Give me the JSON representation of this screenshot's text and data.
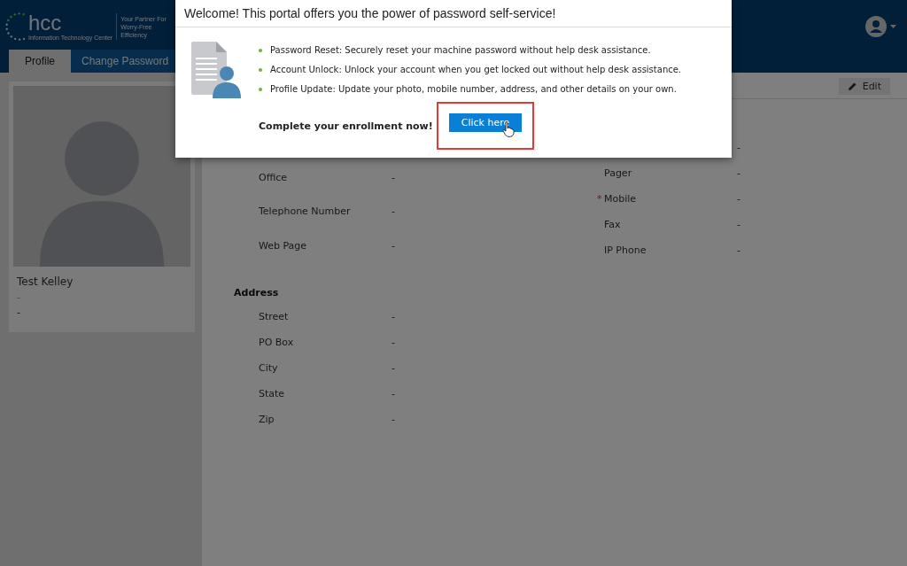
{
  "header": {
    "logo": {
      "wordmark": "hcc",
      "subtitle": "Information Technology Center"
    },
    "tagline": [
      "Your Partner For",
      "Worry-Free Efficiency"
    ]
  },
  "tabs": [
    {
      "label": "Profile",
      "selected": true
    },
    {
      "label": "Change Password",
      "selected": false
    }
  ],
  "profile_card": {
    "name": "Test Kelley",
    "lines": [
      "-",
      "-"
    ]
  },
  "toolbar": {
    "edit": "Edit"
  },
  "fields_left": [
    {
      "label": "Office",
      "value": "-"
    },
    {
      "label": "Telephone Number",
      "value": "-"
    },
    {
      "label": "Web Page",
      "value": "-"
    }
  ],
  "fields_right": [
    {
      "value": "-"
    },
    {
      "label": "Pager",
      "value": "-"
    },
    {
      "label": "Mobile",
      "value": "-",
      "required_mark": "*"
    },
    {
      "label": "Fax",
      "value": "-"
    },
    {
      "label": "IP Phone",
      "value": "-"
    }
  ],
  "address": {
    "heading": "Address",
    "fields": [
      {
        "label": "Street",
        "value": "-"
      },
      {
        "label": "PO Box",
        "value": "-"
      },
      {
        "label": "City",
        "value": "-"
      },
      {
        "label": "State",
        "value": "-"
      },
      {
        "label": "Zip",
        "value": "-"
      }
    ]
  },
  "dialog": {
    "title": "Welcome! This portal offers you the power of password self-service!",
    "bullets": [
      "Password Reset: Securely reset your machine password without help desk assistance.",
      "Account Unlock: Unlock your account when you get locked out without help desk assistance.",
      "Profile Update: Update your photo, mobile number, address, and other details on your own."
    ],
    "prompt": "Complete your enrollment now!",
    "button": "Click here",
    "highlighted": true
  }
}
